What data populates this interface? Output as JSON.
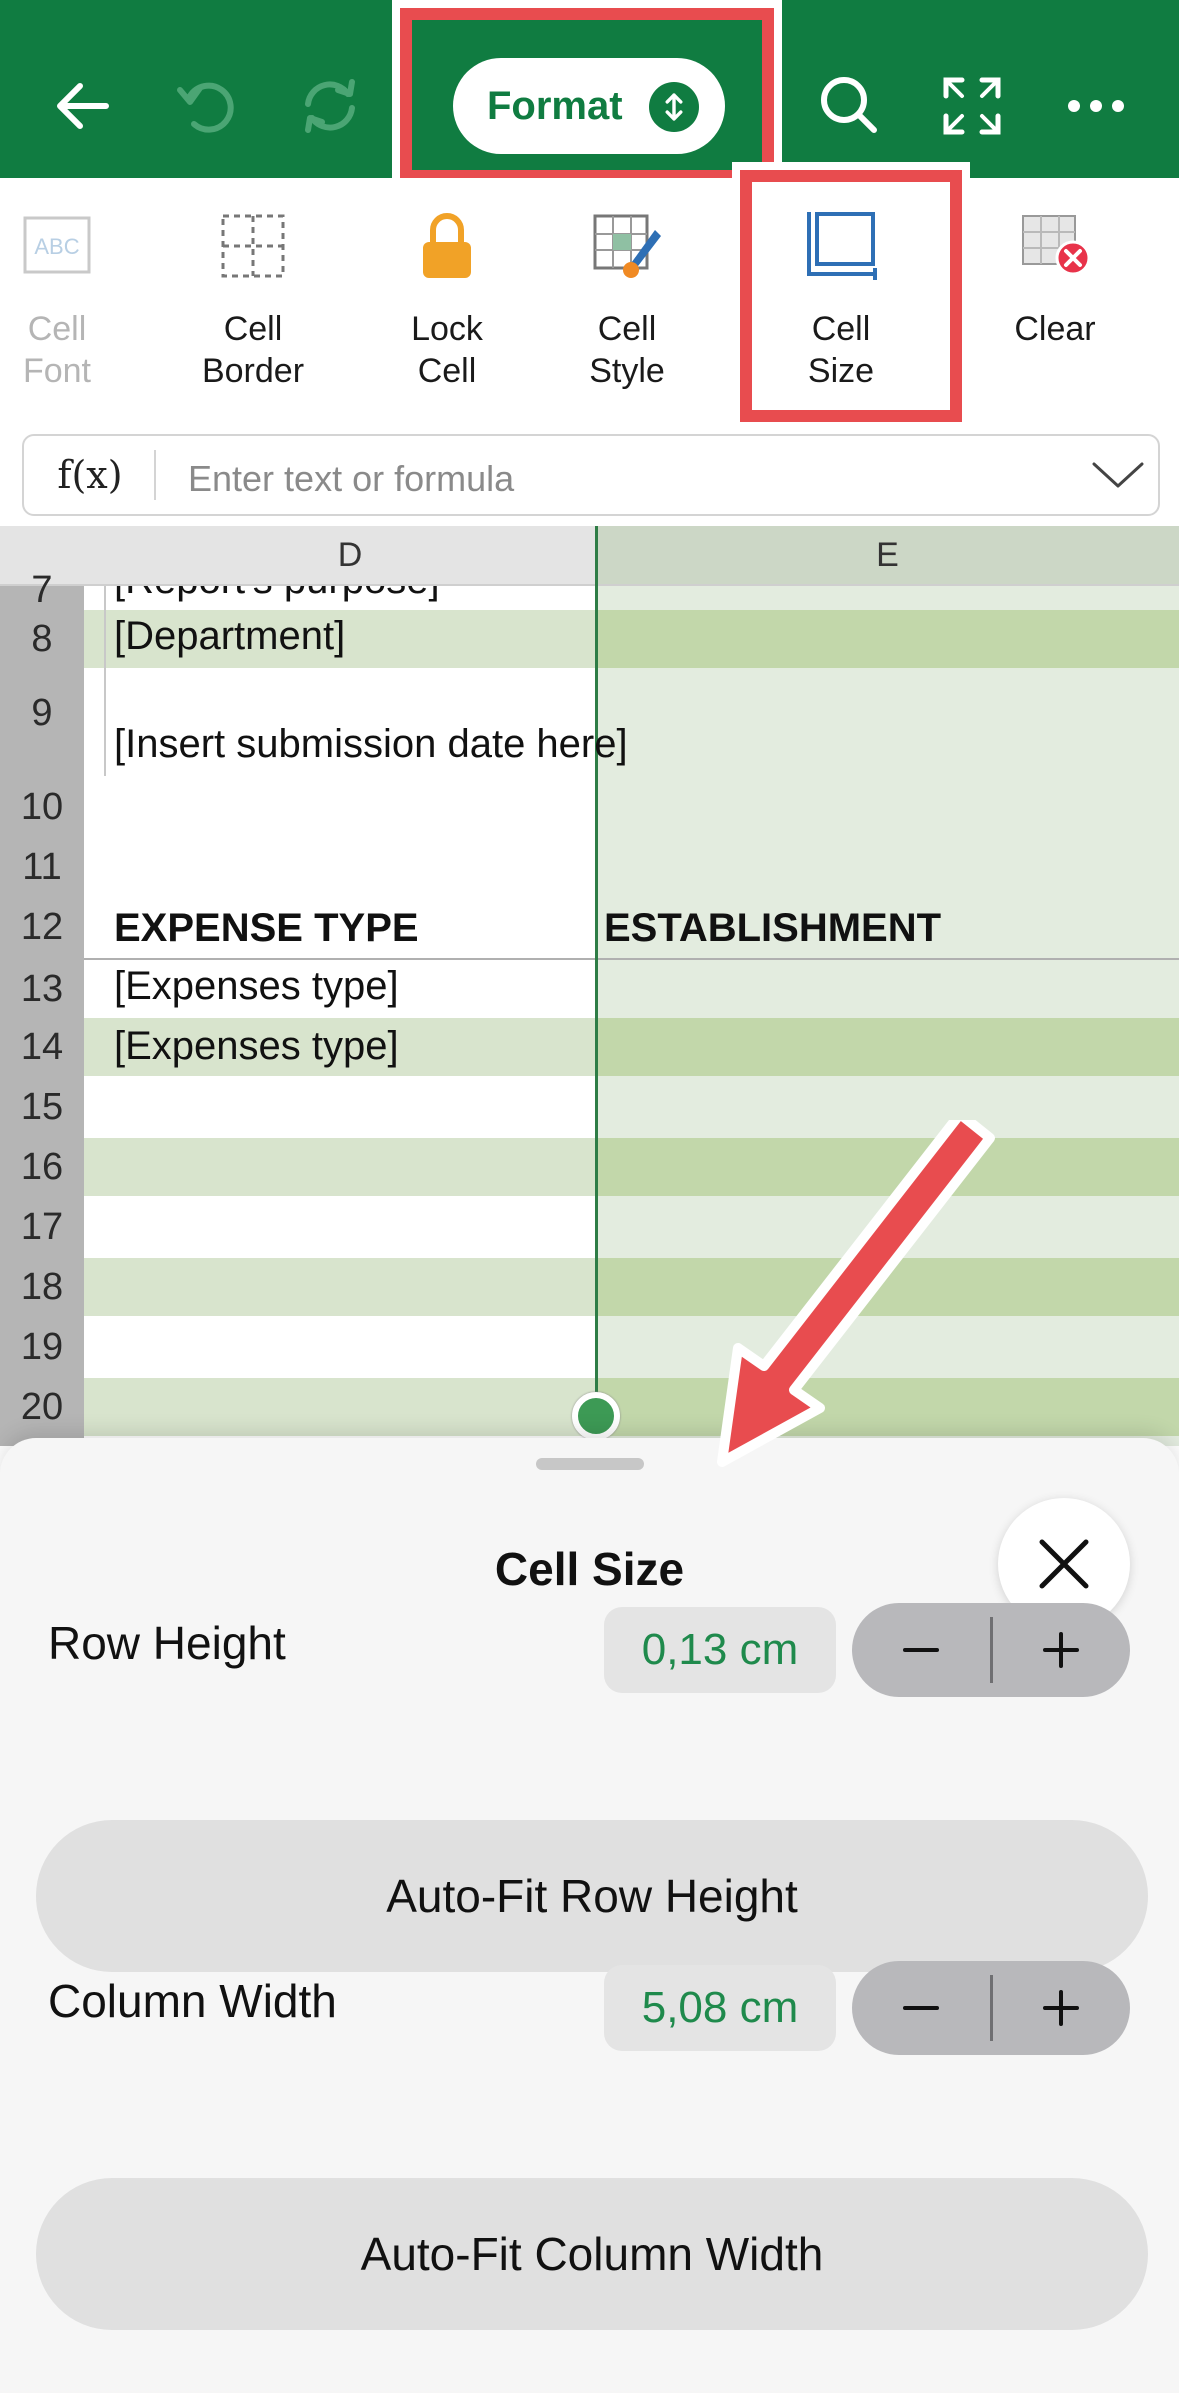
{
  "toolbar": {
    "back_icon": "arrow-left-icon",
    "undo_icon": "undo-icon",
    "redo_icon": "redo-icon",
    "format_label": "Format",
    "search_icon": "search-icon",
    "fullscreen_icon": "fullscreen-icon",
    "more_icon": "more-icon",
    "color": "#107c41"
  },
  "ribbon": {
    "items": [
      {
        "label": "Cell\nFont",
        "icon": "cell-font-icon",
        "disabled": true
      },
      {
        "label": "Cell\nBorder",
        "icon": "cell-border-icon"
      },
      {
        "label": "Lock\nCell",
        "icon": "lock-icon"
      },
      {
        "label": "Cell\nStyle",
        "icon": "cell-style-icon"
      },
      {
        "label": "Cell\nSize",
        "icon": "cell-size-icon",
        "selected": true
      },
      {
        "label": "Clear",
        "icon": "clear-icon"
      }
    ]
  },
  "formula_bar": {
    "fx_label": "f(x)",
    "placeholder": "Enter text or formula"
  },
  "grid": {
    "columns": [
      "D",
      "E"
    ],
    "rows": [
      {
        "num": "7",
        "d": "[Report's purpose]"
      },
      {
        "num": "8",
        "d": "[Department]"
      },
      {
        "num": "9",
        "d": "[Insert submission date here]"
      },
      {
        "num": "10",
        "d": ""
      },
      {
        "num": "11",
        "d": ""
      },
      {
        "num": "12",
        "d": "EXPENSE TYPE",
        "e": "ESTABLISHMENT"
      },
      {
        "num": "13",
        "d": "[Expenses type]"
      },
      {
        "num": "14",
        "d": "[Expenses type]"
      },
      {
        "num": "15",
        "d": ""
      },
      {
        "num": "16",
        "d": ""
      },
      {
        "num": "17",
        "d": ""
      },
      {
        "num": "18",
        "d": ""
      },
      {
        "num": "19",
        "d": ""
      },
      {
        "num": "20",
        "d": ""
      }
    ]
  },
  "sheet": {
    "title": "Cell Size",
    "row_height_label": "Row Height",
    "row_height_value": "0,13 cm",
    "autofit_row_label": "Auto-Fit Row Height",
    "column_width_label": "Column Width",
    "column_width_value": "5,08 cm",
    "autofit_column_label": "Auto-Fit Column Width",
    "minus": "−",
    "plus": "+",
    "value_color": "#1f8a4c"
  },
  "annotation_color": "#e84c4f"
}
